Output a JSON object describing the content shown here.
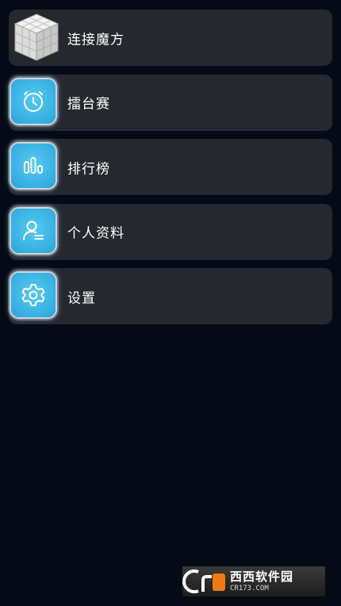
{
  "menu": {
    "items": [
      {
        "label": "连接魔方",
        "icon": "rubiks-cube-icon"
      },
      {
        "label": "擂台赛",
        "icon": "stopwatch-icon"
      },
      {
        "label": "排行榜",
        "icon": "bar-chart-icon"
      },
      {
        "label": "个人资料",
        "icon": "user-profile-icon"
      },
      {
        "label": "设置",
        "icon": "gear-icon"
      }
    ]
  },
  "watermark": {
    "main": "西西软件园",
    "sub": "CR173.COM"
  },
  "colors": {
    "background": "#040b14",
    "item_background": "#26282f",
    "icon_accent": "#36b1e3",
    "watermark_accent": "#f07a12"
  }
}
